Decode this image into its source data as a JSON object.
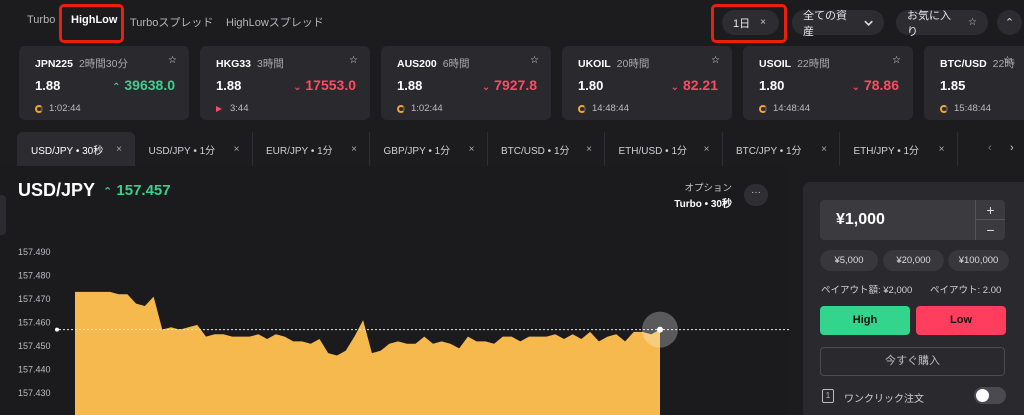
{
  "nav": {
    "tabs": [
      "Turbo",
      "HighLow",
      "Turboスプレッド",
      "HighLowスプレッド"
    ],
    "active": "HighLow",
    "filter_period": "1日",
    "filter_period_close": "×",
    "filter_assets": "全ての資産",
    "favorites": "お気に入り",
    "star": "☆",
    "collapse": "⌃",
    "highlight_color": "#e8200e"
  },
  "cards": [
    {
      "symbol": "JPN225",
      "time": "2時間30分",
      "payout": "1.88",
      "direction": "up",
      "price": "39638.0",
      "countdown": "1:02:44",
      "countdown_type": "ring"
    },
    {
      "symbol": "HKG33",
      "time": "3時間",
      "payout": "1.88",
      "direction": "down",
      "price": "17553.0",
      "countdown": "3:44",
      "countdown_type": "triangle"
    },
    {
      "symbol": "AUS200",
      "time": "6時間",
      "payout": "1.88",
      "direction": "down",
      "price": "7927.8",
      "countdown": "1:02:44",
      "countdown_type": "ring"
    },
    {
      "symbol": "UKOIL",
      "time": "20時間",
      "payout": "1.80",
      "direction": "down",
      "price": "82.21",
      "countdown": "14:48:44",
      "countdown_type": "ring"
    },
    {
      "symbol": "USOIL",
      "time": "22時間",
      "payout": "1.80",
      "direction": "down",
      "price": "78.86",
      "countdown": "14:48:44",
      "countdown_type": "ring"
    },
    {
      "symbol": "BTC/USD",
      "time": "22時",
      "payout": "1.85",
      "direction": "",
      "price": "",
      "countdown": "15:48:44",
      "countdown_type": "ring"
    }
  ],
  "asset_tabs": [
    "USD/JPY • 30秒",
    "USD/JPY • 1分",
    "EUR/JPY • 1分",
    "GBP/JPY • 1分",
    "BTC/USD • 1分",
    "ETH/USD • 1分",
    "BTC/JPY • 1分",
    "ETH/JPY • 1分"
  ],
  "asset_tab_close": "×",
  "scroll_left": "‹",
  "scroll_right": "›",
  "chart": {
    "symbol": "USD/JPY",
    "price": "157.457",
    "option_label": "オプション",
    "option_value": "Turbo • 30秒",
    "more": "···"
  },
  "chart_data": {
    "type": "area",
    "yticks": [
      157.49,
      157.48,
      157.47,
      157.46,
      157.45,
      157.44,
      157.43
    ],
    "ytick_labels": [
      "157.490",
      "157.480",
      "157.470",
      "157.460",
      "157.450",
      "157.440",
      "157.430"
    ],
    "ylim": [
      157.425,
      157.495
    ],
    "current_level": 157.457,
    "fill_color": "#f6b94e",
    "values": [
      157.473,
      157.473,
      157.473,
      157.473,
      157.473,
      157.472,
      157.472,
      157.468,
      157.467,
      157.471,
      157.457,
      157.458,
      157.457,
      157.458,
      157.459,
      157.454,
      157.455,
      157.455,
      157.454,
      157.454,
      157.454,
      157.455,
      157.453,
      157.455,
      157.454,
      157.452,
      157.452,
      157.451,
      157.453,
      157.447,
      157.446,
      157.448,
      157.454,
      157.461,
      157.447,
      157.448,
      157.451,
      157.452,
      157.451,
      157.451,
      157.454,
      157.451,
      157.452,
      157.451,
      157.449,
      157.454,
      157.452,
      157.452,
      157.451,
      157.454,
      157.454,
      157.452,
      157.454,
      157.454,
      157.454,
      157.455,
      157.453,
      157.455,
      157.453,
      157.456,
      157.452,
      157.454,
      157.455,
      157.452,
      157.456,
      157.456,
      157.455,
      157.457
    ]
  },
  "order": {
    "amount": "¥1,000",
    "plus": "+",
    "minus": "−",
    "presets": [
      "¥5,000",
      "¥20,000",
      "¥100,000"
    ],
    "payout_amount": "ペイアウト額: ¥2,000",
    "payout_rate": "ペイアウト: 2.00",
    "high": "High",
    "low": "Low",
    "buy_now": "今すぐ購入",
    "oneclick_icon": "1",
    "oneclick": "ワンクリック注文",
    "high_color": "#33d58d",
    "low_color": "#ff3d5c"
  }
}
